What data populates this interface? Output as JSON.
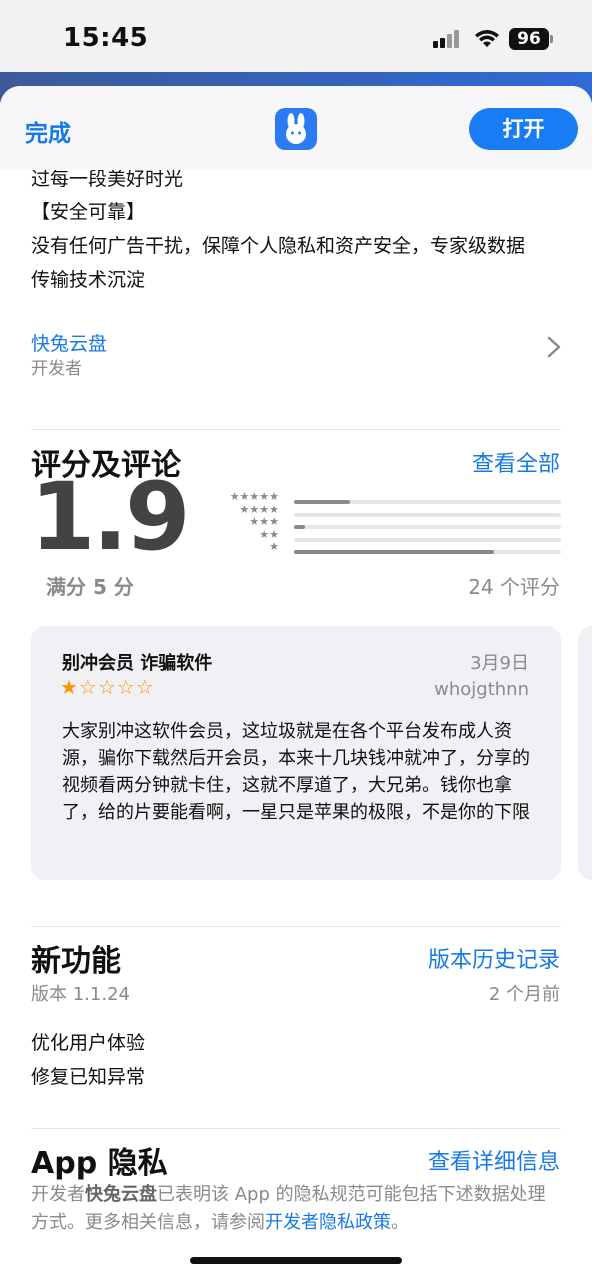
{
  "status": {
    "time": "15:45",
    "battery": "96"
  },
  "nav": {
    "done_label": "完成",
    "open_label": "打开"
  },
  "description": {
    "lines": [
      "过每一段美好时光",
      "【安全可靠】",
      "没有任何广告干扰，保障个人隐私和资产安全，专家级数据",
      "传输技术沉淀"
    ]
  },
  "developer": {
    "name": "快兔云盘",
    "label": "开发者"
  },
  "ratings": {
    "title": "评分及评论",
    "see_all": "查看全部",
    "score": "1.9",
    "out_of": "满分 5 分",
    "count_label": "24 个评分",
    "distribution": [
      {
        "stars": "★★★★★",
        "fraction": 0.21
      },
      {
        "stars": "★★★★",
        "fraction": 0.0
      },
      {
        "stars": "★★★",
        "fraction": 0.04
      },
      {
        "stars": "★★",
        "fraction": 0.0
      },
      {
        "stars": "★",
        "fraction": 0.75
      }
    ]
  },
  "review": {
    "title": "别冲会员 诈骗软件",
    "date": "3月9日",
    "author": "whojgthnn",
    "rating_stars": "★☆☆☆☆",
    "rating": 1,
    "body": "大家别冲这软件会员，这垃圾就是在各个平台发布成人资源，骗你下载然后开会员，本来十几块钱冲就冲了，分享的视频看两分钟就卡住，这就不厚道了，大兄弟。钱你也拿了，给的片要能看啊，一星只是苹果的极限，不是你的下限"
  },
  "whats_new": {
    "title": "新功能",
    "history_link": "版本历史记录",
    "version": "版本 1.1.24",
    "ago": "2 个月前",
    "notes": [
      "优化用户体验",
      "修复已知异常"
    ]
  },
  "privacy": {
    "title": "App 隐私",
    "detail_link": "查看详细信息",
    "text_prefix": "开发者",
    "developer": "快兔云盘",
    "text_middle": "已表明该 App 的隐私规范可能包括下述数据处理方式。更多相关信息，请参阅",
    "policy_link": "开发者隐私政策",
    "text_suffix": "。"
  },
  "colors": {
    "accent": "#1779e8",
    "star": "#ff9500",
    "secondary_text": "#8a8a8e"
  },
  "icons": [
    "signal-icon",
    "wifi-icon",
    "battery-icon",
    "app-icon-rabbit",
    "chevron-right-icon"
  ]
}
